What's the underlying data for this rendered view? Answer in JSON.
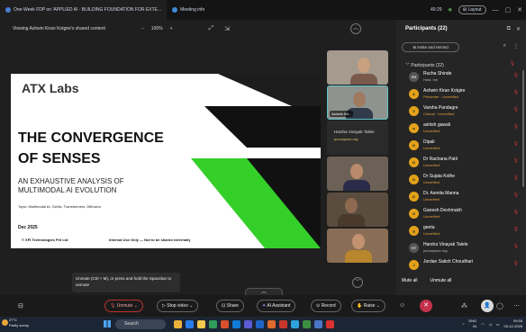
{
  "titlebar": {
    "tab1": "One-Week FDP on 'APPLIED AI - BUILDING FOUNDATION FOR EXTE...",
    "tab2": "Meeting info",
    "timer": "40:29",
    "layout": "Layout",
    "minimize": "—",
    "maximize": "▢",
    "close": "✕"
  },
  "sharebar": {
    "text": "Viewing Ashwin Kiran Kotgire's shared content",
    "zoom_out": "−",
    "zoom": "100%",
    "zoom_in": "+"
  },
  "slide": {
    "logo": "ATX Labs",
    "title1": "THE CONVERGENCE",
    "title2": "OF SENSES",
    "sub1": "AN EXHAUSTIVE ANALYSIS OF",
    "sub2": "MULTIMODAL AI EVOLUTION",
    "topic": "Topic: Multimodal AI, GANs, Transformers, Diffusion",
    "date": "Dec 2025",
    "copyright": "© XFI Technologies Pvt Ltd",
    "internal": "Internal Use Only — Not to be shared externally"
  },
  "tiles": {
    "presenter_label": "Ashwin Kir...",
    "harsha_name": "Harsha Vinayak Talele",
    "harsha_email": "pccoepune.org"
  },
  "participants": {
    "title": "Participants (22)",
    "invite": "Invite and remind",
    "list_header": "Participants (22)",
    "mute_all": "Mute all",
    "unmute_all": "Unmute all",
    "people": [
      {
        "initials": "RS",
        "name": "Rucha Shinde",
        "sub": "Host, me",
        "grey": true
      },
      {
        "initials": "A",
        "name": "Ashwin Kiran Kotgire",
        "sub": "Presenter · Unverified",
        "grey": false
      },
      {
        "initials": "V",
        "name": "Varsha Pandagre",
        "sub": "Cohost · Unverified",
        "grey": false
      },
      {
        "initials": "a",
        "name": "ashish gawali",
        "sub": "Unverified",
        "grey": false
      },
      {
        "initials": "D",
        "name": "Dipali",
        "sub": "Unverified",
        "grey": false
      },
      {
        "initials": "D",
        "name": "Dr Rachana Patil",
        "sub": "Unverified",
        "grey": false
      },
      {
        "initials": "D",
        "name": "Dr Sujata Kolhe",
        "sub": "Unverified",
        "grey": false
      },
      {
        "initials": "D",
        "name": "Dr. Asmita Manna",
        "sub": "Unverified",
        "grey": false
      },
      {
        "initials": "G",
        "name": "Ganesh Deshmukh",
        "sub": "Unverified",
        "grey": false
      },
      {
        "initials": "g",
        "name": "geeta",
        "sub": "Unverified",
        "grey": false
      },
      {
        "initials": "HT",
        "name": "Harsha Vinayak Talele",
        "sub": "pccoepune.org",
        "grey": true
      },
      {
        "initials": "J",
        "name": "Jordan Satish Choudhari",
        "sub": "",
        "grey": false
      }
    ]
  },
  "tooltip": "Unmute (Ctrl + M), or press and hold the Spacebar to unmute",
  "toolbar": {
    "unmute": "Unmute",
    "stop_video": "Stop video",
    "share": "Share",
    "ai_assistant": "AI Assistant",
    "record": "Record",
    "raise": "Raise"
  },
  "taskbar": {
    "weather_temp": "27°C",
    "weather_desc": "Partly sunny",
    "search": "Search",
    "lang1": "ENG",
    "lang2": "IN",
    "time": "09:55",
    "date": "03-12-2025"
  }
}
